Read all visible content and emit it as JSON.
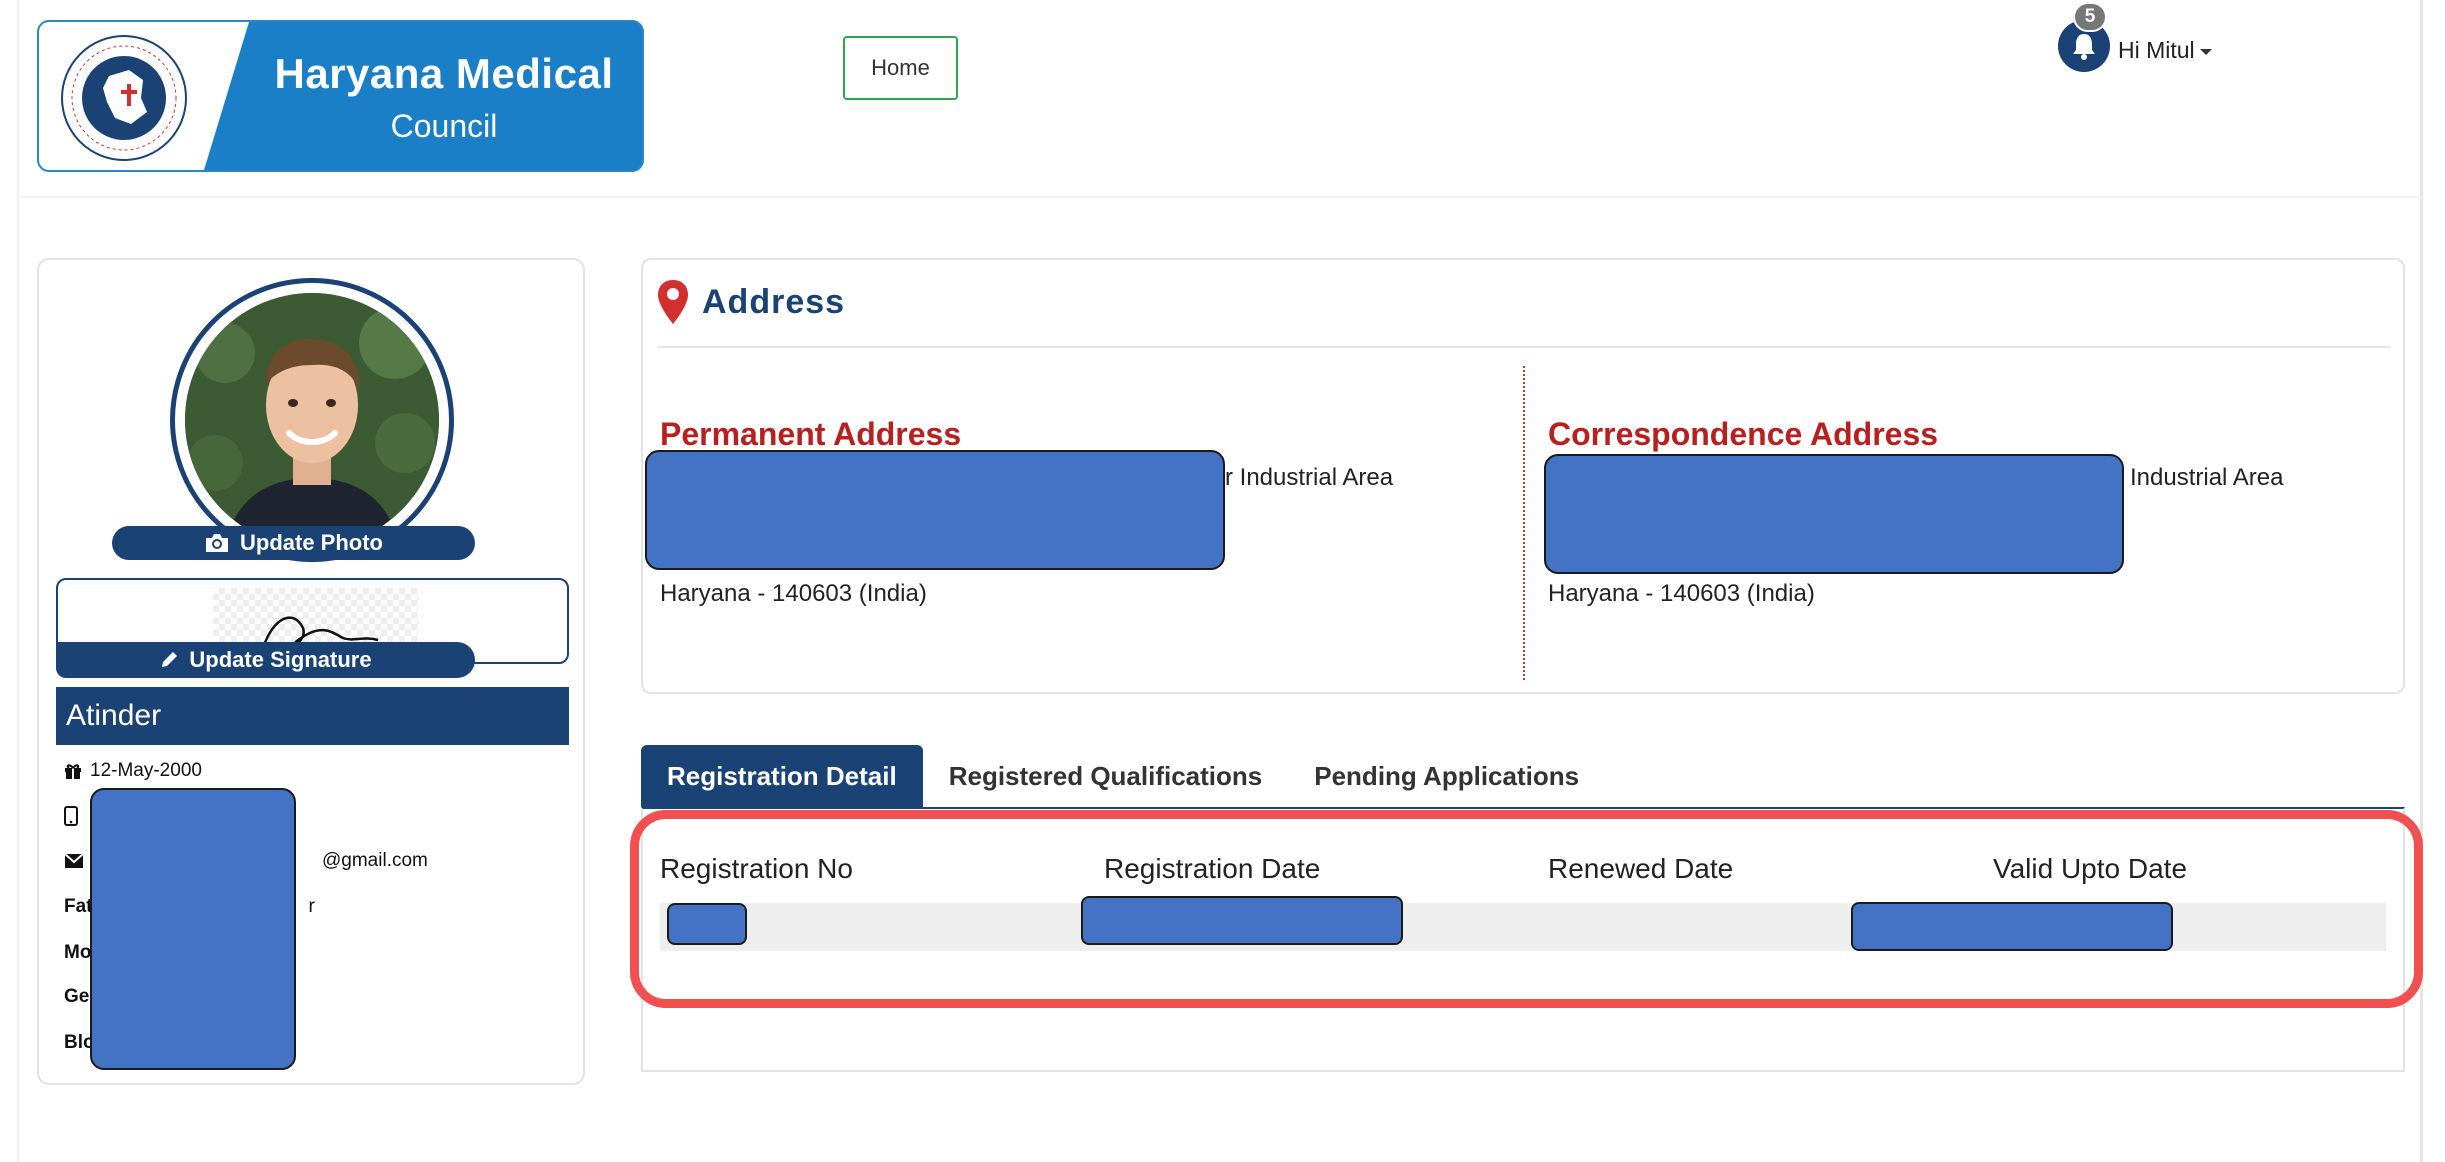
{
  "header": {
    "logo_title": "Haryana Medical",
    "logo_subtitle": "Council",
    "nav_home": "Home",
    "notification_count": "5",
    "user_greeting": "Hi Mitul"
  },
  "profile": {
    "update_photo_label": "Update Photo",
    "update_signature_label": "Update Signature",
    "name": "Atinder",
    "dob": "12-May-2000",
    "email_suffix": "@gmail.com",
    "father_label_fragment": "Fat",
    "father_value_fragment": "r",
    "mother_label_fragment": "Mo",
    "gender_label_fragment": "Ge",
    "blood_label_fragment": "Blo"
  },
  "address": {
    "title": "Address",
    "permanent": {
      "heading": "Permanent Address",
      "line1_fragment": "r Industrial Area",
      "line2": "Haryana - 140603  (India)"
    },
    "correspondence": {
      "heading": "Correspondence Address",
      "line1_fragment": "Industrial Area",
      "line2": "Haryana - 140603  (India)"
    }
  },
  "tabs": [
    {
      "label": "Registration Detail",
      "active": true
    },
    {
      "label": "Registered Qualifications",
      "active": false
    },
    {
      "label": "Pending Applications",
      "active": false
    }
  ],
  "registration": {
    "columns": [
      "Registration No",
      "Registration Date",
      "Renewed Date",
      "Valid Upto Date"
    ]
  },
  "colors": {
    "brand_navy": "#1a4275",
    "address_red": "#b81f1f",
    "highlight": "#f05050",
    "redaction": "#4472c4"
  }
}
